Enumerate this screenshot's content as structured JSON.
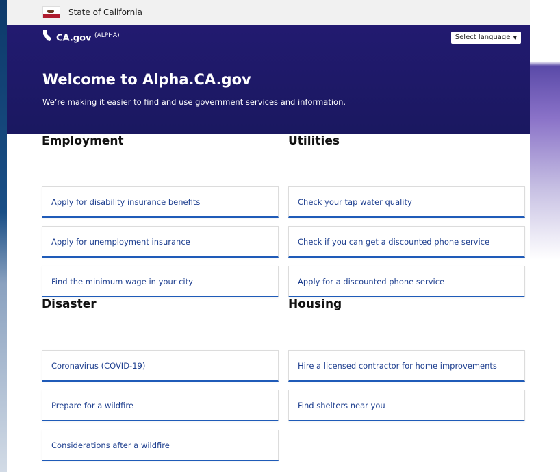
{
  "utility": {
    "state_label": "State of California"
  },
  "header": {
    "brand_name": "CA.gov",
    "brand_suffix": "(ALPHA)",
    "language_button": "Select language"
  },
  "hero": {
    "title": "Welcome to Alpha.CA.gov",
    "subtitle": "We’re making it easier to find and use government services and information."
  },
  "sections": {
    "employment": {
      "title": "Employment",
      "links": [
        "Apply for disability insurance benefits",
        "Apply for unemployment insurance",
        "Find the minimum wage in your city"
      ]
    },
    "utilities": {
      "title": "Utilities",
      "links": [
        "Check your tap water quality",
        "Check if you can get a discounted phone service",
        "Apply for a discounted phone service"
      ]
    },
    "disaster": {
      "title": "Disaster",
      "links": [
        "Coronavirus (COVID-19)",
        "Prepare for a wildfire",
        "Considerations after a wildfire"
      ]
    },
    "housing": {
      "title": "Housing",
      "links": [
        "Hire a licensed contractor for home improvements",
        "Find shelters near you"
      ]
    }
  },
  "colors": {
    "hero_bg": "#1e1868",
    "link_text": "#1e3f8f",
    "card_accent": "#1f5bb8"
  }
}
